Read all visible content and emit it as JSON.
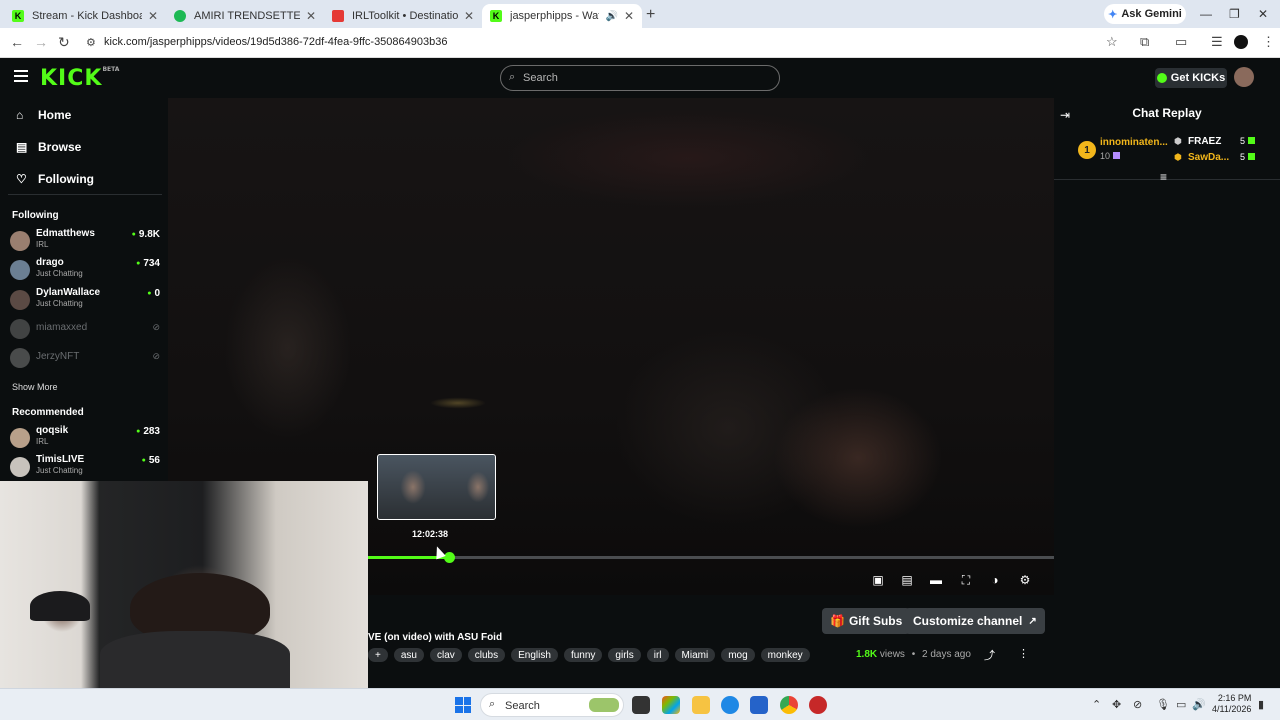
{
  "browser": {
    "tabs": [
      {
        "title": "Stream - Kick Dashboard",
        "favicon": "K",
        "color": "#53fc18"
      },
      {
        "title": "AMIRI TRENDSETTER • Rich Am",
        "favicon": "",
        "color": "#1db954"
      },
      {
        "title": "IRLToolkit • Destinations",
        "favicon": "",
        "color": "#e53935"
      },
      {
        "title": "jasperphipps - Watch the V",
        "favicon": "K",
        "color": "#53fc18"
      }
    ],
    "ask_gemini": "Ask Gemini",
    "url": "kick.com/jasperphipps/videos/19d5d386-72df-4fea-9ffc-350864903b36"
  },
  "header": {
    "logo": "KICK",
    "logo_badge": "BETA",
    "search_placeholder": "Search",
    "get_kicks": "Get KICKs"
  },
  "sidebar": {
    "nav": [
      {
        "label": "Home",
        "icon": "home-icon"
      },
      {
        "label": "Browse",
        "icon": "browse-icon"
      },
      {
        "label": "Following",
        "icon": "heart-icon"
      }
    ],
    "following_heading": "Following",
    "following": [
      {
        "name": "Edmatthews",
        "category": "IRL",
        "viewers": "9.8K",
        "avatar": "#9a7f70"
      },
      {
        "name": "drago",
        "category": "Just Chatting",
        "viewers": "734",
        "avatar": "#6b7f93"
      },
      {
        "name": "DylanWallace",
        "category": "Just Chatting",
        "viewers": "0",
        "avatar": "#5b4a44"
      },
      {
        "name": "miamaxxed",
        "category": "",
        "viewers": "",
        "avatar": "#777"
      },
      {
        "name": "JerzyNFT",
        "category": "",
        "viewers": "",
        "avatar": "#888"
      }
    ],
    "show_more": "Show More",
    "recommended_heading": "Recommended",
    "recommended": [
      {
        "name": "qoqsik",
        "category": "IRL",
        "viewers": "283",
        "avatar": "#b8a08a"
      },
      {
        "name": "TimisLIVE",
        "category": "Just Chatting",
        "viewers": "56",
        "avatar": "#c7c2bc"
      }
    ]
  },
  "player": {
    "preview_time": "12:02:38",
    "progress": 0.117,
    "controls": [
      "miniplayer-icon",
      "theater-icon",
      "cinema-icon",
      "fullscreen-icon",
      "speed-icon",
      "settings-icon"
    ]
  },
  "chat": {
    "title": "Chat Replay",
    "leader": {
      "rank": "1",
      "name": "innominaten...",
      "count": "10"
    },
    "gifters": [
      {
        "name": "FRAEZ",
        "count": "5",
        "color": "#ffffff"
      },
      {
        "name": "SawDa...",
        "count": "5",
        "color": "#f2b61b"
      }
    ]
  },
  "video_info": {
    "title": "VE (on video) with ASU Foid",
    "tags": [
      "+",
      "asu",
      "clav",
      "clubs",
      "English",
      "funny",
      "girls",
      "irl",
      "Miami",
      "mog",
      "monkey"
    ],
    "gift_subs": "Gift Subs",
    "customize": "Customize channel",
    "views_count": "1.8K",
    "views_label": "views",
    "age": "2 days ago"
  },
  "taskbar": {
    "search": "Search",
    "time": "2:16 PM",
    "date": "4/11/2026"
  }
}
